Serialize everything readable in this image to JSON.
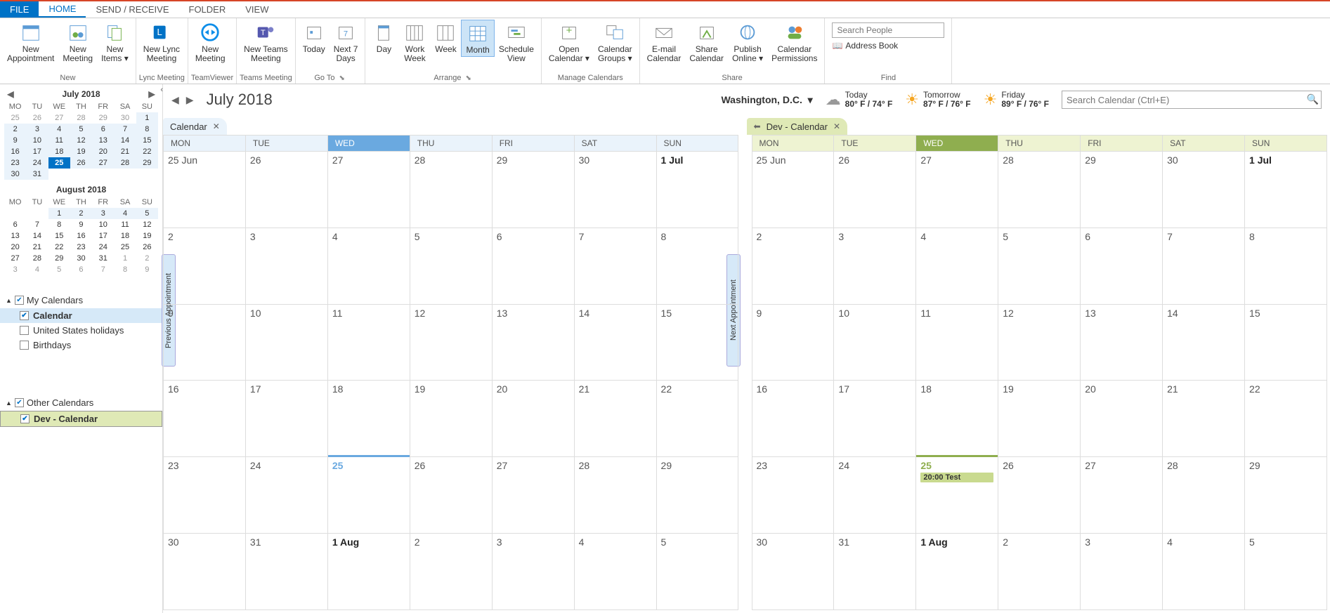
{
  "tabs": {
    "file": "FILE",
    "home": "HOME",
    "sendreceive": "SEND / RECEIVE",
    "folder": "FOLDER",
    "view": "VIEW"
  },
  "ribbon": {
    "new": {
      "label": "New",
      "items": {
        "appt": "New\nAppointment",
        "meeting": "New\nMeeting",
        "items": "New\nItems ▾"
      }
    },
    "lync": {
      "label": "Lync Meeting",
      "item": "New Lync\nMeeting"
    },
    "tv": {
      "label": "TeamViewer",
      "item": "New\nMeeting"
    },
    "teams": {
      "label": "Teams Meeting",
      "item": "New Teams\nMeeting"
    },
    "goto": {
      "label": "Go To",
      "today": "Today",
      "next7": "Next 7\nDays"
    },
    "arrange": {
      "label": "Arrange",
      "day": "Day",
      "workweek": "Work\nWeek",
      "week": "Week",
      "month": "Month",
      "schedule": "Schedule\nView"
    },
    "manage": {
      "label": "Manage Calendars",
      "open": "Open\nCalendar ▾",
      "groups": "Calendar\nGroups ▾"
    },
    "share": {
      "label": "Share",
      "email": "E-mail\nCalendar",
      "share": "Share\nCalendar",
      "publish": "Publish\nOnline ▾",
      "perms": "Calendar\nPermissions"
    },
    "find": {
      "label": "Find",
      "search_ph": "Search People",
      "addr": "Address Book"
    }
  },
  "mini1": {
    "title": "July 2018",
    "dow": [
      "MO",
      "TU",
      "WE",
      "TH",
      "FR",
      "SA",
      "SU"
    ],
    "rows": [
      [
        {
          "n": "25",
          "o": 1
        },
        {
          "n": "26",
          "o": 1
        },
        {
          "n": "27",
          "o": 1
        },
        {
          "n": "28",
          "o": 1
        },
        {
          "n": "29",
          "o": 1
        },
        {
          "n": "30",
          "o": 1
        },
        {
          "n": "1"
        }
      ],
      [
        {
          "n": "2"
        },
        {
          "n": "3"
        },
        {
          "n": "4"
        },
        {
          "n": "5"
        },
        {
          "n": "6"
        },
        {
          "n": "7"
        },
        {
          "n": "8"
        }
      ],
      [
        {
          "n": "9"
        },
        {
          "n": "10"
        },
        {
          "n": "11"
        },
        {
          "n": "12"
        },
        {
          "n": "13"
        },
        {
          "n": "14"
        },
        {
          "n": "15"
        }
      ],
      [
        {
          "n": "16"
        },
        {
          "n": "17"
        },
        {
          "n": "18"
        },
        {
          "n": "19"
        },
        {
          "n": "20"
        },
        {
          "n": "21"
        },
        {
          "n": "22"
        }
      ],
      [
        {
          "n": "23"
        },
        {
          "n": "24"
        },
        {
          "n": "25",
          "t": 1
        },
        {
          "n": "26"
        },
        {
          "n": "27"
        },
        {
          "n": "28"
        },
        {
          "n": "29"
        }
      ],
      [
        {
          "n": "30"
        },
        {
          "n": "31"
        },
        {
          "n": ""
        },
        {
          "n": ""
        },
        {
          "n": ""
        },
        {
          "n": ""
        },
        {
          "n": ""
        }
      ]
    ]
  },
  "mini2": {
    "title": "August 2018",
    "rows": [
      [
        {
          "n": ""
        },
        {
          "n": ""
        },
        {
          "n": "1",
          "s": 1
        },
        {
          "n": "2",
          "s": 1
        },
        {
          "n": "3",
          "s": 1
        },
        {
          "n": "4",
          "s": 1
        },
        {
          "n": "5",
          "s": 1
        }
      ],
      [
        {
          "n": "6"
        },
        {
          "n": "7"
        },
        {
          "n": "8"
        },
        {
          "n": "9"
        },
        {
          "n": "10"
        },
        {
          "n": "11"
        },
        {
          "n": "12"
        }
      ],
      [
        {
          "n": "13"
        },
        {
          "n": "14"
        },
        {
          "n": "15"
        },
        {
          "n": "16"
        },
        {
          "n": "17"
        },
        {
          "n": "18"
        },
        {
          "n": "19"
        }
      ],
      [
        {
          "n": "20"
        },
        {
          "n": "21"
        },
        {
          "n": "22"
        },
        {
          "n": "23"
        },
        {
          "n": "24"
        },
        {
          "n": "25"
        },
        {
          "n": "26"
        }
      ],
      [
        {
          "n": "27"
        },
        {
          "n": "28"
        },
        {
          "n": "29"
        },
        {
          "n": "30"
        },
        {
          "n": "31"
        },
        {
          "n": "1",
          "o": 1
        },
        {
          "n": "2",
          "o": 1
        }
      ],
      [
        {
          "n": "3",
          "o": 1
        },
        {
          "n": "4",
          "o": 1
        },
        {
          "n": "5",
          "o": 1
        },
        {
          "n": "6",
          "o": 1
        },
        {
          "n": "7",
          "o": 1
        },
        {
          "n": "8",
          "o": 1
        },
        {
          "n": "9",
          "o": 1
        }
      ]
    ]
  },
  "myCal": {
    "head": "My Calendars",
    "items": [
      {
        "name": "Calendar",
        "chk": true,
        "sel": "blue"
      },
      {
        "name": "United States holidays",
        "chk": false
      },
      {
        "name": "Birthdays",
        "chk": false
      }
    ]
  },
  "otherCal": {
    "head": "Other Calendars",
    "items": [
      {
        "name": "Dev - Calendar",
        "chk": true,
        "sel": "green"
      }
    ]
  },
  "topbar": {
    "title": "July 2018",
    "location": "Washington, D.C.",
    "weather": [
      {
        "ico": "☁",
        "day": "Today",
        "temp": "80° F / 74° F"
      },
      {
        "ico": "☀",
        "day": "Tomorrow",
        "temp": "87° F / 76° F"
      },
      {
        "ico": "☀",
        "day": "Friday",
        "temp": "89° F / 76° F"
      }
    ],
    "search_ph": "Search Calendar (Ctrl+E)"
  },
  "calTabs": {
    "left": "Calendar",
    "right": "Dev - Calendar"
  },
  "gridHead": [
    "MON",
    "TUE",
    "WED",
    "THU",
    "FRI",
    "SAT",
    "SUN"
  ],
  "weeks": [
    [
      {
        "n": "25 Jun"
      },
      {
        "n": "26"
      },
      {
        "n": "27"
      },
      {
        "n": "28"
      },
      {
        "n": "29"
      },
      {
        "n": "30"
      },
      {
        "n": "1 Jul",
        "b": 1
      }
    ],
    [
      {
        "n": "2"
      },
      {
        "n": "3"
      },
      {
        "n": "4"
      },
      {
        "n": "5"
      },
      {
        "n": "6"
      },
      {
        "n": "7"
      },
      {
        "n": "8"
      }
    ],
    [
      {
        "n": "9"
      },
      {
        "n": "10"
      },
      {
        "n": "11"
      },
      {
        "n": "12"
      },
      {
        "n": "13"
      },
      {
        "n": "14"
      },
      {
        "n": "15"
      }
    ],
    [
      {
        "n": "16"
      },
      {
        "n": "17"
      },
      {
        "n": "18"
      },
      {
        "n": "19"
      },
      {
        "n": "20"
      },
      {
        "n": "21"
      },
      {
        "n": "22"
      }
    ],
    [
      {
        "n": "23"
      },
      {
        "n": "24"
      },
      {
        "n": "25",
        "today": 1
      },
      {
        "n": "26"
      },
      {
        "n": "27"
      },
      {
        "n": "28"
      },
      {
        "n": "29"
      }
    ],
    [
      {
        "n": "30"
      },
      {
        "n": "31"
      },
      {
        "n": "1 Aug",
        "b": 1
      },
      {
        "n": "2"
      },
      {
        "n": "3"
      },
      {
        "n": "4"
      },
      {
        "n": "5"
      }
    ]
  ],
  "event": "20:00 Test",
  "apptNav": {
    "prev": "Previous Appointment",
    "next": "Next Appointment"
  }
}
